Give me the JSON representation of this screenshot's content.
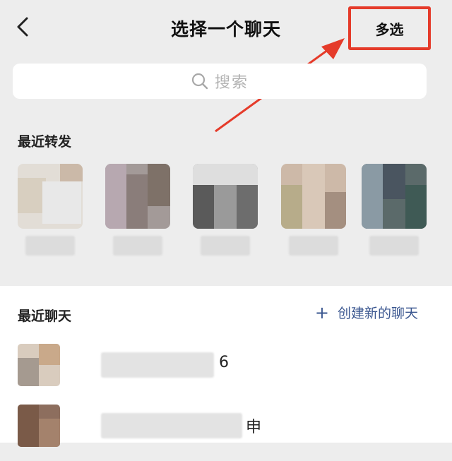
{
  "header": {
    "title": "选择一个聊天",
    "multi_select_label": "多选"
  },
  "search": {
    "placeholder": "搜索"
  },
  "recent_forward": {
    "title": "最近转发",
    "count": 5
  },
  "recent_chats": {
    "title": "最近聊天",
    "create_label": "创建新的聊天",
    "items": [
      {
        "name_suffix": "6"
      },
      {
        "name_suffix": "申"
      }
    ]
  },
  "colors": {
    "highlight": "#e53b2a",
    "link": "#3b5790",
    "background": "#ededed"
  },
  "icons": {
    "back": "chevron-left-icon",
    "search": "search-icon",
    "plus": "plus-icon"
  }
}
